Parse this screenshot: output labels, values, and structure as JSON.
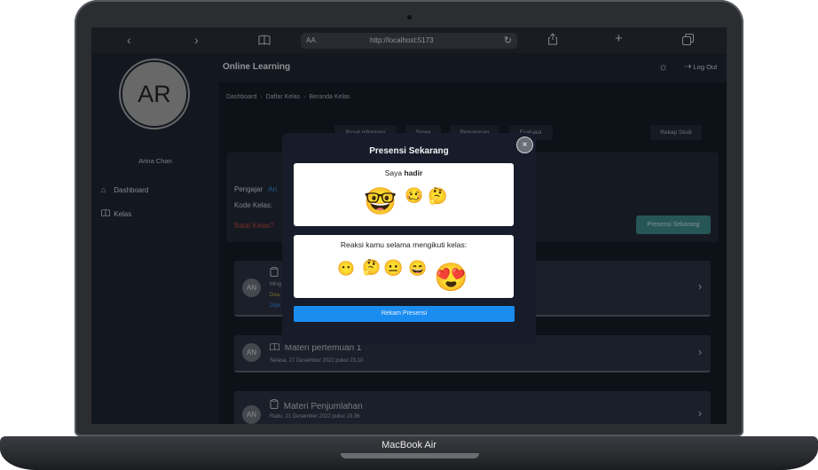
{
  "device": {
    "brand": "MacBook Air"
  },
  "browser": {
    "back_icon": "chevron-left-icon",
    "forward_icon": "chevron-right-icon",
    "text_size": "AA",
    "url": "http://localhost:5173"
  },
  "sidebar": {
    "avatar_initials": "AR",
    "username": "Arina Chan",
    "items": [
      {
        "label": "Dashboard",
        "icon": "home-icon"
      },
      {
        "label": "Kelas",
        "icon": "book-icon"
      }
    ]
  },
  "topbar": {
    "title": "Online Learning",
    "logout": "Log Out"
  },
  "breadcrumb": [
    "Dashboard",
    "Daftar Kelas",
    "Beranda Kelas"
  ],
  "tabs": [
    "Pusat Informasi",
    "Siswa",
    "Penugasan",
    "Evaluasi",
    "Rekap Studi"
  ],
  "class_info": {
    "teacher_label": "Pengajar",
    "teacher_value": "An",
    "code_label": "Kode Kelas:",
    "cancel": "Batal Kelas?",
    "presensi_button": "Presensi Sekarang"
  },
  "items": [
    {
      "avatar": "AN",
      "title": "",
      "sub1": "Ming",
      "sub2": "Dea",
      "sub3": "Dipe"
    },
    {
      "avatar": "AN",
      "title": "Materi pertemuan 1",
      "sub1": "Selasa, 27 Desember 2022 pukul 23.10"
    },
    {
      "avatar": "AN",
      "title": "Materi Penjumlahan",
      "sub1": "Rabu, 21 Desember 2022 pukul 19.36"
    }
  ],
  "modal": {
    "title": "Presensi Sekarang",
    "close": "×",
    "attend_prefix": "Saya ",
    "attend_bold": "hadir",
    "attend_emojis": [
      "🤓",
      "🥴",
      "🤔"
    ],
    "reaction_label": "Reaksi kamu selama mengikuti kelas:",
    "reaction_emojis": [
      "😶",
      "🤔",
      "😐",
      "😄",
      "😍"
    ],
    "submit": "Rekam Presensi"
  },
  "colors": {
    "primary": "#1a8cf0",
    "teal": "#3f8c8c",
    "danger": "#c0493d",
    "link": "#3d8ee8"
  }
}
